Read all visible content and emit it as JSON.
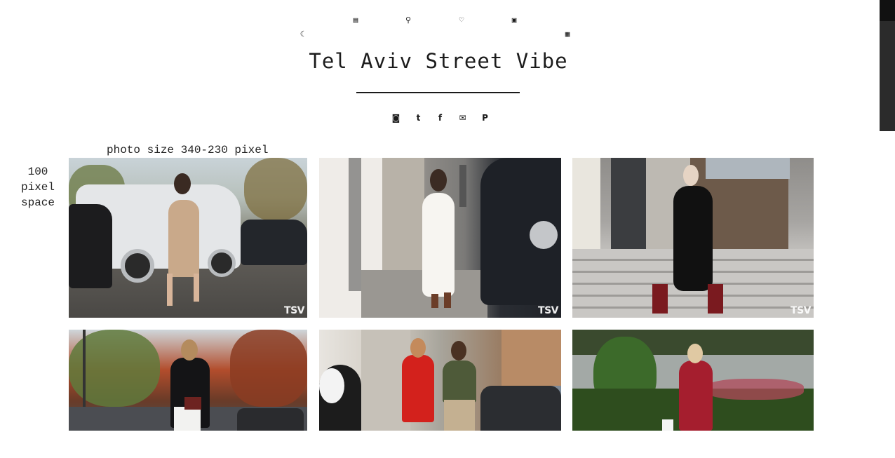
{
  "header": {
    "title": "Tel Aviv Street Vibe",
    "nav_icons": [
      {
        "name": "comment-icon",
        "glyph": "▤"
      },
      {
        "name": "search-icon",
        "glyph": "⚲"
      },
      {
        "name": "heart-icon",
        "glyph": "♡"
      },
      {
        "name": "bookmark-icon",
        "glyph": "▣"
      }
    ],
    "left_icon": {
      "name": "moon-icon",
      "glyph": "☾"
    },
    "right_icon": {
      "name": "grid-icon",
      "glyph": "▦"
    }
  },
  "social": [
    {
      "name": "instagram-icon",
      "glyph": "◙"
    },
    {
      "name": "tumblr-icon",
      "glyph": "t"
    },
    {
      "name": "facebook-icon",
      "glyph": "f"
    },
    {
      "name": "mail-icon",
      "glyph": "✉"
    },
    {
      "name": "pinterest-icon",
      "glyph": "P"
    }
  ],
  "notes": {
    "photo_size": "photo size 340-230 pixel",
    "space_lines": [
      "100",
      "pixel",
      "space"
    ]
  },
  "photos": [
    {
      "name": "photo-street-1",
      "watermark": "TSV"
    },
    {
      "name": "photo-street-2",
      "watermark": "TSV"
    },
    {
      "name": "photo-street-3",
      "watermark": "TSV"
    },
    {
      "name": "photo-street-4",
      "watermark": ""
    },
    {
      "name": "photo-street-5",
      "watermark": ""
    },
    {
      "name": "photo-street-6",
      "watermark": ""
    }
  ],
  "colors": {
    "text": "#1a1a1a",
    "background": "#ffffff",
    "scrollbar": "#2b2b2b"
  }
}
